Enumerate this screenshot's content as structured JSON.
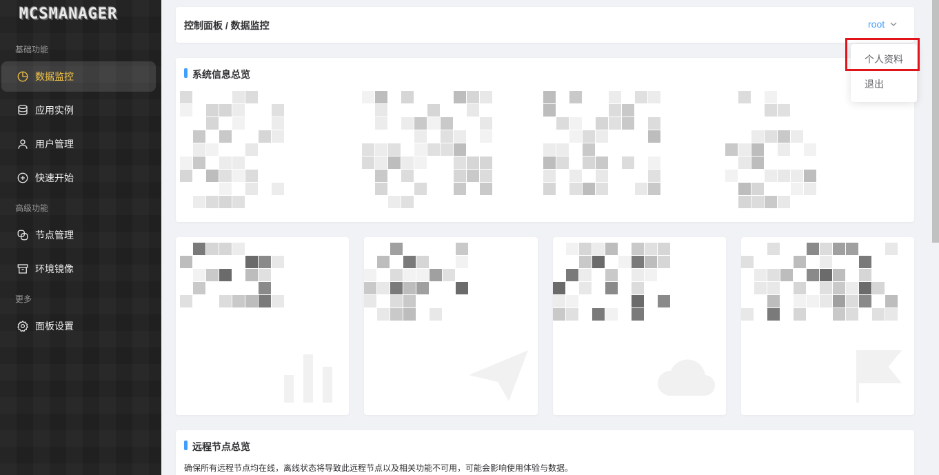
{
  "app": {
    "logo_text": "MCSMANAGER",
    "brand_accent": "#f7c744",
    "link_color": "#409eff",
    "highlight_color": "#e1141c"
  },
  "sidebar": {
    "groups": [
      {
        "label": "基础功能"
      },
      {
        "label": "高级功能"
      },
      {
        "label": "更多"
      }
    ],
    "items": [
      {
        "label": "数据监控",
        "icon": "pie-chart-icon",
        "active": true
      },
      {
        "label": "应用实例",
        "icon": "database-icon"
      },
      {
        "label": "用户管理",
        "icon": "user-icon"
      },
      {
        "label": "快速开始",
        "icon": "plus-circle-icon"
      },
      {
        "label": "节点管理",
        "icon": "link-icon"
      },
      {
        "label": "环境镜像",
        "icon": "archive-box-icon"
      },
      {
        "label": "面板设置",
        "icon": "gear-icon"
      }
    ]
  },
  "header": {
    "breadcrumb": "控制面板 / 数据监控",
    "user": "root"
  },
  "user_dropdown": {
    "items": [
      {
        "label": "个人资料"
      },
      {
        "label": "退出"
      }
    ]
  },
  "sections": {
    "system_overview": "系统信息总览",
    "remote_nodes": "远程节点总览"
  },
  "remote_nodes_desc": "确保所有远程节点均在线，离线状态将导致此远程节点以及相关功能不可用，可能会影响使用体验与数据。"
}
